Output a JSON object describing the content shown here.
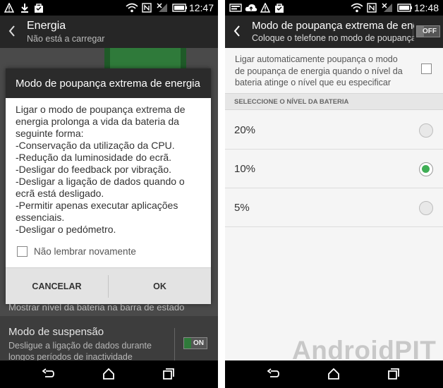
{
  "left": {
    "status_time": "12:47",
    "actionbar_title": "Energia",
    "actionbar_subtitle": "Não está a carregar",
    "dialog": {
      "title": "Modo de poupança extrema de energia",
      "body_lines": [
        "Ligar o modo de poupança extrema de",
        "energia prolonga a vida da bateria da",
        "seguinte forma:",
        "-Conservação da utilização da CPU.",
        "-Redução da luminosidade do ecrã.",
        "-Desligar do feedback por vibração.",
        "-Desligar a ligação de dados quando o",
        "ecrã está desligado.",
        "-Permitir apenas executar aplicações",
        "essenciais.",
        "-Desligar o pedómetro."
      ],
      "checkbox_label": "Não lembrar novamente",
      "cancel_label": "CANCELAR",
      "ok_label": "OK"
    },
    "background": {
      "battery_bar_text": "Mostrar nível da bateria na barra de estado",
      "sleep_title": "Modo de suspensão",
      "sleep_desc_1": "Desligue a ligação de dados durante",
      "sleep_desc_2": "longos períodos de inactividade",
      "sleep_toggle": "ON"
    }
  },
  "right": {
    "status_time": "12:48",
    "actionbar_title": "Modo de poupança extrema de energia",
    "actionbar_subtitle": "Coloque o telefone no modo de poupança",
    "toggle_label": "OFF",
    "auto_desc": [
      "Ligar automaticamente poupança o modo",
      "de poupança de energia quando o nível da",
      "bateria atinge o nível que eu especificar"
    ],
    "section_header": "SELECCIONE O NÍVEL DA BATERIA",
    "levels": [
      {
        "label": "20%",
        "selected": false
      },
      {
        "label": "10%",
        "selected": true
      },
      {
        "label": "5%",
        "selected": false
      }
    ]
  },
  "watermark": "AndroidPIT",
  "colors": {
    "accent_green": "#3fae55",
    "dialog_title_bg": "#2b2b2b"
  }
}
